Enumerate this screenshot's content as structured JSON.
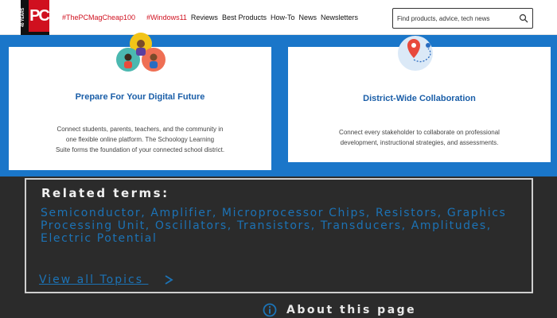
{
  "header": {
    "logo_text": "PC",
    "logo_side": "40 YEARS",
    "hashtags": [
      "#ThePCMagCheap100",
      "#Windows11"
    ],
    "nav_links": [
      "Reviews",
      "Best Products",
      "How-To",
      "News",
      "Newsletters"
    ],
    "search_placeholder": "Find products, advice, tech news"
  },
  "cards": [
    {
      "title": "Prepare For Your Digital Future",
      "lines": [
        "Connect students, parents, teachers, and the community in",
        "one flexible online platform. The Schoology Learning",
        "Suite forms the foundation of your connected school district."
      ],
      "icon": "community-people-icon"
    },
    {
      "title": "District-Wide Collaboration",
      "lines": [
        "Connect every stakeholder to collaborate on professional",
        "development, instructional strategies, and assessments."
      ],
      "icon": "map-pin-route-icon"
    }
  ],
  "related": {
    "heading": "Related terms:",
    "terms": [
      "Semiconductor",
      "Amplifier",
      "Microprocessor Chips",
      "Resistors",
      "Graphics Processing Unit",
      "Oscillators",
      "Transistors",
      "Transducers",
      "Amplitudes",
      "Electric Potential"
    ],
    "view_all": "View all Topics"
  },
  "about": {
    "label": "About this page",
    "icon": "info-circle-icon"
  },
  "colors": {
    "accent_blue": "#1a76c9",
    "link_blue": "#1c73b6",
    "brand_red": "#d0101f",
    "dark_bg": "#2b2b2b"
  }
}
